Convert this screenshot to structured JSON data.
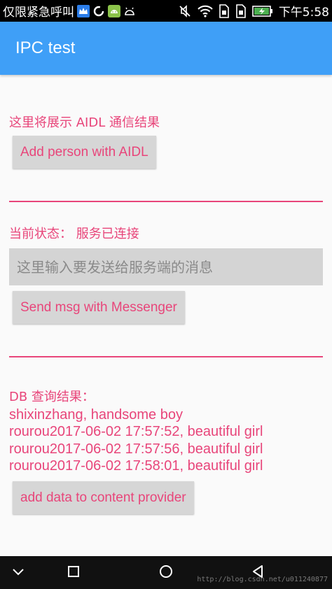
{
  "status_bar": {
    "carrier": "仅限紧急呼叫",
    "time": "下午5:58",
    "icons": [
      "crown-icon",
      "sync-icon",
      "android-icon",
      "android-debug-icon",
      "mute-icon",
      "wifi-icon",
      "sim1-icon",
      "sim2-icon",
      "battery-charging-icon"
    ]
  },
  "app_bar": {
    "title": "IPC test"
  },
  "aidl": {
    "label": "这里将展示 AIDL 通信结果",
    "button_label": "Add person with AIDL"
  },
  "messenger": {
    "status_label": "当前状态： 服务已连接",
    "input_placeholder": "这里输入要发送给服务端的消息",
    "input_value": "",
    "button_label": "Send msg with Messenger"
  },
  "db": {
    "header": "DB 查询结果：",
    "rows": [
      "shixinzhang, handsome boy",
      "rourou2017-06-02 17:57:52, beautiful girl",
      "rourou2017-06-02 17:57:56, beautiful girl",
      "rourou2017-06-02 17:58:01, beautiful girl"
    ],
    "button_label": "add data to content provider"
  },
  "nav_bar": {
    "watermark": "http://blog.csdn.net/u011240877"
  },
  "colors": {
    "accent_pink": "#e8457a",
    "app_bar_blue": "#3f9ff7",
    "button_grey": "#d6d6d6"
  }
}
